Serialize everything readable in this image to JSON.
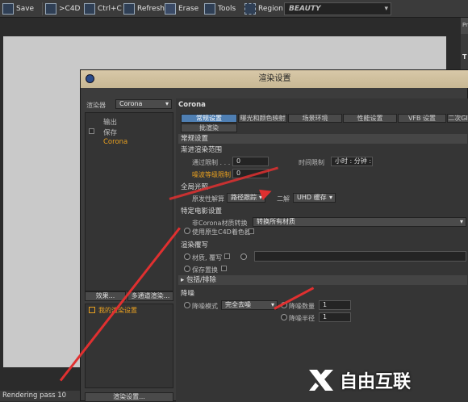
{
  "toolbar": {
    "save": "Save",
    "c4d": ">C4D",
    "ctrlc": "Ctrl+C",
    "refresh": "Refresh",
    "erase": "Erase",
    "tools": "Tools",
    "region": "Region",
    "scene": "BEAUTY"
  },
  "status": "Rendering pass 10",
  "right_edge": {
    "p": "Pr",
    "t": "T"
  },
  "dialog": {
    "title": "渲染设置",
    "renderer_label": "渲染器",
    "renderer_value": "Corona",
    "tree": [
      "输出",
      "保存",
      "Corona"
    ],
    "effects_button": "效果...",
    "multipass_button": "多通道渲染...",
    "my_settings": "我的渲染设置",
    "render_settings_button": "渲染设置...",
    "panel_title": "Corona",
    "tabs": [
      "常规设置",
      "曝光和颜色映射",
      "场景环境",
      "性能设置",
      "VFB 设置",
      "二次GI",
      "批渲染"
    ],
    "general_header": "常规设置",
    "progressive_header": "渐进渲染范围",
    "pass_limit_label": "通过限制 . . . .",
    "pass_limit_value": "0",
    "time_limit_label": "时间限制",
    "time_limit_value": "小时 : 分钟 :",
    "noise_limit_label": "噪波等级限制",
    "noise_limit_value": "0",
    "gi_header": "全局光照",
    "primary_solver_label": "原发性解算",
    "primary_solver_value": "路径跟踪",
    "secondary_label": "二解",
    "secondary_value": "UHD 缓存",
    "material_header": "特定电影设置",
    "non_corona_label": "非Corona材质转换",
    "non_corona_value": "转换所有材质",
    "c4d_shader_label": "使用原生C4D着色器",
    "override_header": "渲染覆写",
    "mtl_override_label": "材质, 覆写",
    "keep_replace_label": "保存置换",
    "include_exclude_label": "包括/排除",
    "denoise_header": "降噪",
    "denoise_mode_label": "降噪模式",
    "denoise_mode_value": "完全去噪",
    "denoise_amount_label": "降噪数量",
    "denoise_amount_value": "1",
    "denoise_radius_label": "降噪半径",
    "denoise_radius_value": "1"
  },
  "watermark": "自由互联",
  "colors": {
    "accent_tab": "#4f7fb3",
    "highlight": "#e8a020",
    "arrow": "#e03030"
  }
}
